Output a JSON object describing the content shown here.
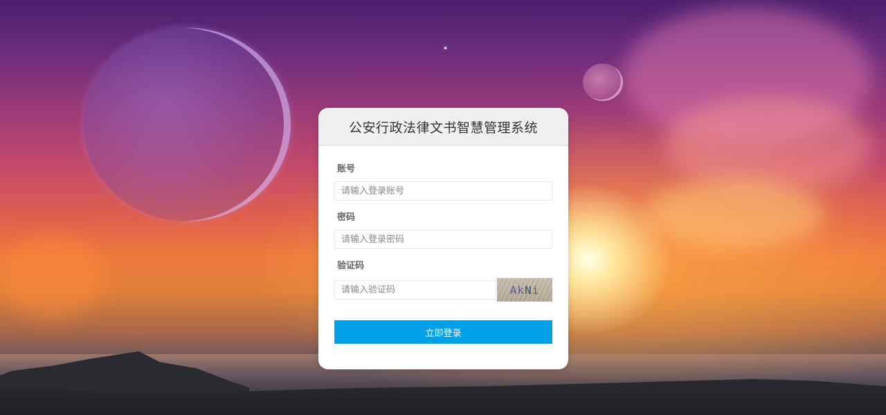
{
  "login": {
    "title": "公安行政法律文书智慧管理系统",
    "account": {
      "label": "账号",
      "placeholder": "请输入登录账号",
      "value": ""
    },
    "password": {
      "label": "密码",
      "placeholder": "请输入登录密码",
      "value": ""
    },
    "captcha": {
      "label": "验证码",
      "placeholder": "请输入验证码",
      "value": "",
      "image_text": [
        "A",
        "k",
        "N",
        "i"
      ]
    },
    "submit_label": "立即登录"
  },
  "colors": {
    "button": "#00a0e9",
    "header_bg": "#efefef"
  }
}
